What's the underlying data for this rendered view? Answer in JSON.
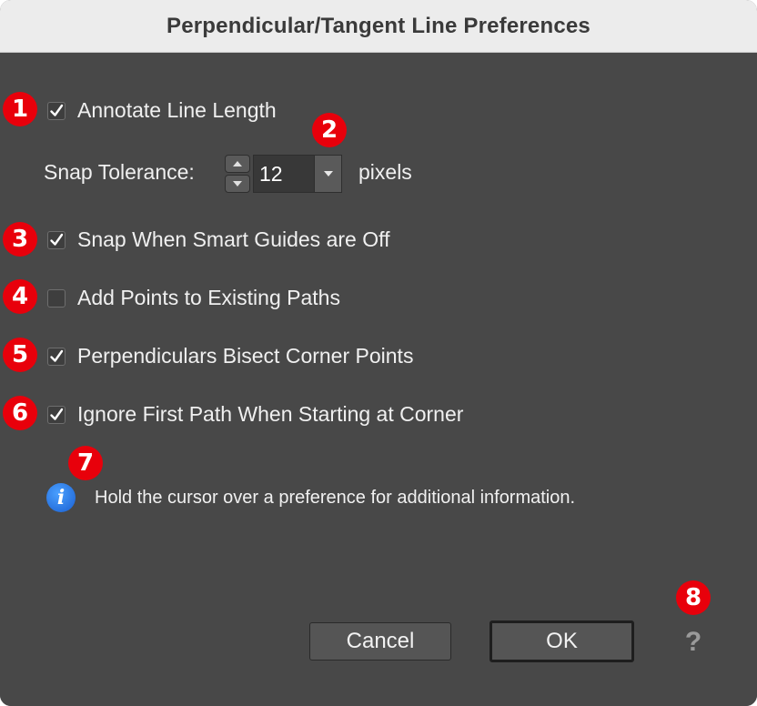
{
  "dialog": {
    "title": "Perpendicular/Tangent Line Preferences"
  },
  "options": [
    {
      "label": "Annotate Line Length",
      "checked": true,
      "badge": "1"
    },
    {
      "label": "Snap When Smart Guides are Off",
      "checked": true,
      "badge": "3"
    },
    {
      "label": "Add Points to Existing Paths",
      "checked": false,
      "badge": "4"
    },
    {
      "label": "Perpendiculars Bisect Corner Points",
      "checked": true,
      "badge": "5"
    },
    {
      "label": "Ignore First Path When Starting at Corner",
      "checked": true,
      "badge": "6"
    }
  ],
  "snap": {
    "label": "Snap Tolerance:",
    "value": "12",
    "units": "pixels",
    "badge": "2"
  },
  "info": {
    "text": "Hold the cursor over a preference for additional information.",
    "icon": "info-icon",
    "badge": "7"
  },
  "buttons": {
    "cancel": "Cancel",
    "ok": "OK",
    "help": "?",
    "help_badge": "8"
  },
  "colors": {
    "background": "#484848",
    "titlebar": "#ececec",
    "badge": "#e8000b",
    "info_icon": "#1a5fd1"
  }
}
